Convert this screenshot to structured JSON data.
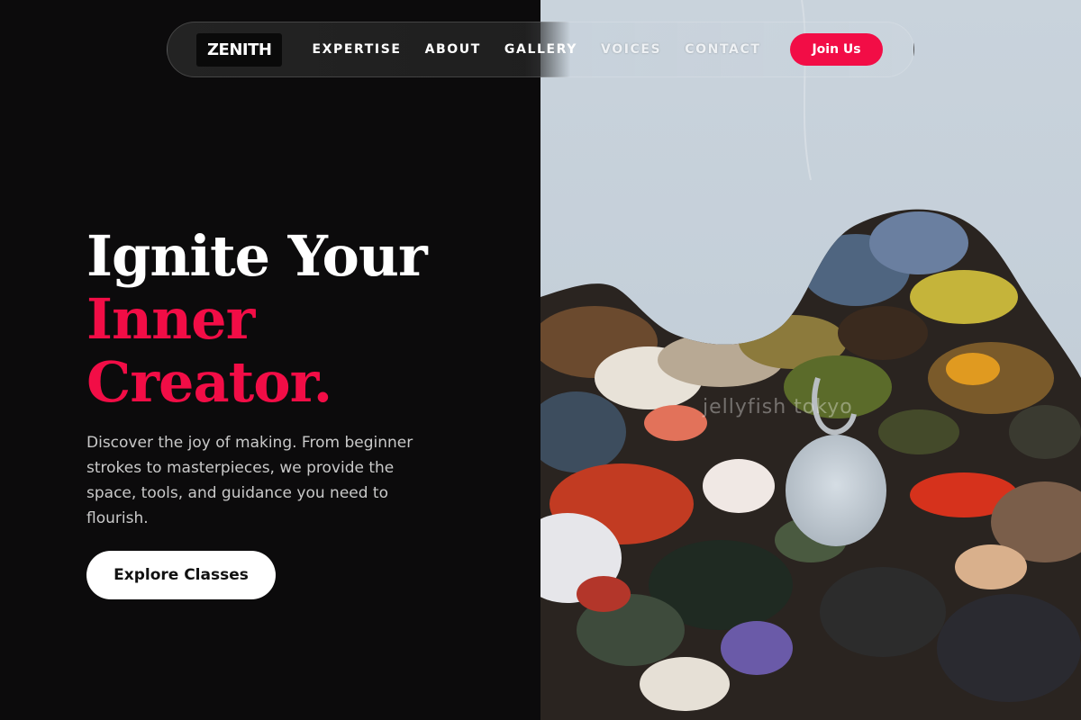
{
  "brand": {
    "logo_text": "ZENITH"
  },
  "nav": {
    "links": [
      "EXPERTISE",
      "ABOUT",
      "GALLERY",
      "VOICES",
      "CONTACT"
    ],
    "join_label": "Join Us"
  },
  "hero": {
    "title_line1": "Ignite Your",
    "title_line2": "Inner",
    "title_line3": "Creator.",
    "description": "Discover the joy of making. From beginner strokes to masterpieces, we provide the space, tools, and guidance you need to flourish.",
    "cta_label": "Explore Classes"
  },
  "image": {
    "subject": "paint-palette",
    "watermark": "jellyfish tokyo"
  },
  "colors": {
    "accent": "#f20d46",
    "background_dark": "#0c0b0c",
    "text_light": "#ffffff",
    "text_muted": "#c9c9c9"
  }
}
